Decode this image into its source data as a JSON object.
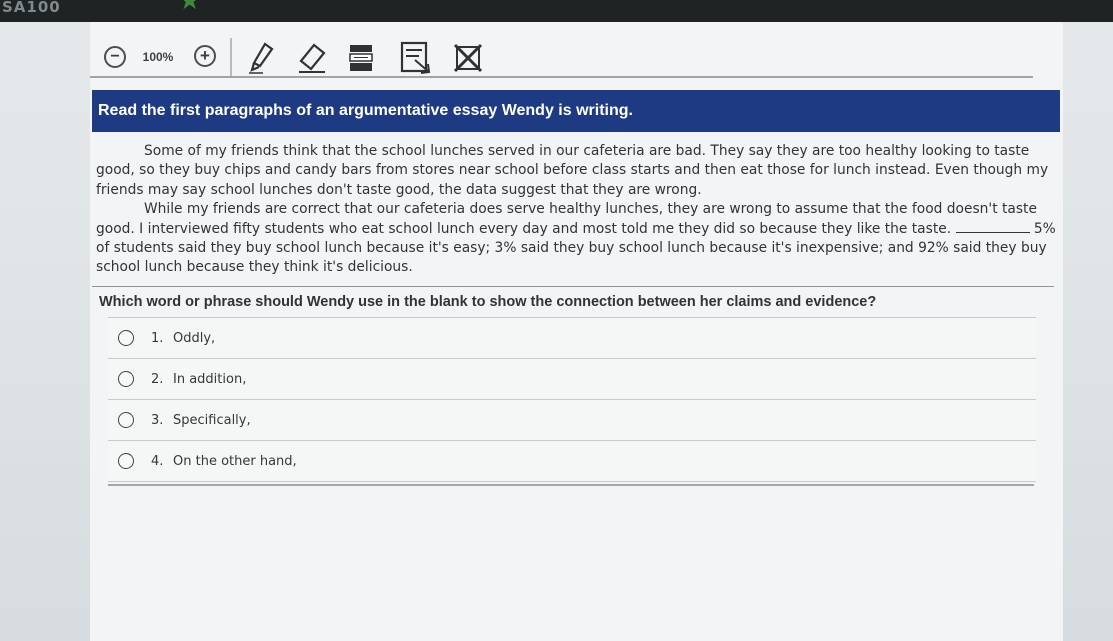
{
  "window": {
    "code": "SA100"
  },
  "toolbar": {
    "zoom_level": "100%",
    "icons": {
      "zoom_out": "zoom-out-icon",
      "zoom_in": "zoom-in-icon",
      "highlighter": "highlighter-icon",
      "eraser": "eraser-icon",
      "line_reader": "line-reader-icon",
      "mask": "mask-icon",
      "eliminator": "answer-eliminator-icon"
    }
  },
  "question": {
    "header": "Read the first paragraphs of an argumentative essay Wendy is writing.",
    "passage": {
      "p1": "Some of my friends think that the school lunches served in our cafeteria are bad. They say they are too healthy looking to taste good, so they buy chips and candy bars from stores near school before class starts and then eat those for lunch instead. Even though my friends may say school lunches don't taste good, the data suggest that they are wrong.",
      "p2_before_blank": "While my friends are correct that our cafeteria does serve healthy lunches, they are wrong to assume that the food doesn't taste good. I interviewed fifty students who eat school lunch every day and most told me they did so because they like the taste.",
      "p2_after_blank": "5% of students said they buy school lunch because it's easy; 3% said they buy school lunch because it's inexpensive; and 92% said they buy school lunch because they think it's delicious."
    },
    "stem": "Which word or phrase should Wendy use in the blank to show the connection between her claims and evidence?",
    "options": [
      {
        "number": "1.",
        "text": "Oddly,"
      },
      {
        "number": "2.",
        "text": "In addition,"
      },
      {
        "number": "3.",
        "text": "Specifically,"
      },
      {
        "number": "4.",
        "text": "On the other hand,"
      }
    ]
  },
  "colors": {
    "header_bg": "#1e3a82",
    "header_text": "#ffffff"
  }
}
